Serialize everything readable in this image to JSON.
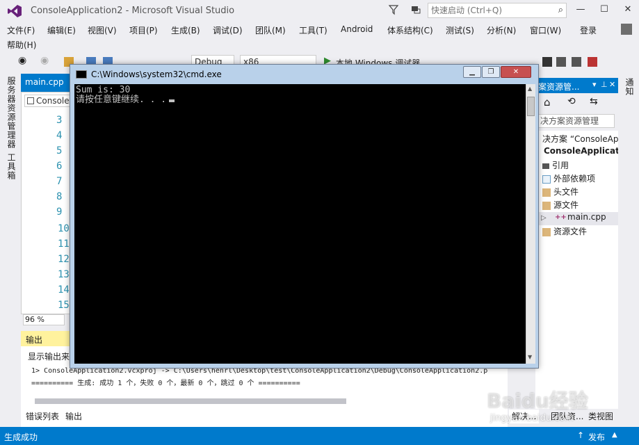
{
  "window": {
    "title": "ConsoleApplication2 - Microsoft Visual Studio",
    "quick_launch_placeholder": "快速启动 (Ctrl+Q)",
    "minimize": "—",
    "maximize": "☐",
    "close": "✕"
  },
  "menu": {
    "items": [
      "文件(F)",
      "编辑(E)",
      "视图(V)",
      "项目(P)",
      "生成(B)",
      "调试(D)",
      "团队(M)",
      "工具(T)",
      "Android",
      "体系结构(C)",
      "测试(S)",
      "分析(N)",
      "窗口(W)"
    ],
    "login": "登录",
    "help": "帮助(H)"
  },
  "toolbar": {
    "config": "Debug",
    "platform": "x86",
    "run": "本地 Windows 调试器"
  },
  "side_tabs": {
    "left": [
      "服务器资源管理器",
      "工具箱"
    ],
    "right": [
      "通知"
    ]
  },
  "editor": {
    "tab": "main.cpp",
    "nav_item": "Console",
    "line_numbers": [
      "3",
      "4",
      "5",
      "6",
      "7",
      "8",
      "9",
      "10",
      "11",
      "12",
      "13",
      "14",
      "15"
    ],
    "zoom": "96 %"
  },
  "output": {
    "title": "输出",
    "source_label": "显示输出来",
    "lines": [
      "1>  ConsoleApplication2.vcxproj -> C:\\Users\\henrl\\Desktop\\test\\ConsoleApplication2\\Debug\\ConsoleApplication2.p",
      "========== 生成: 成功 1 个，失败 0 个，最新 0 个，跳过 0 个 =========="
    ],
    "tabs": [
      "错误列表",
      "输出"
    ]
  },
  "solution_explorer": {
    "title": "案资源管...",
    "search_placeholder": "决方案资源管理",
    "items": [
      {
        "label": "决方案 “ConsoleAp",
        "indent": 0
      },
      {
        "label": "ConsoleApplicati",
        "indent": 0,
        "bold": true
      },
      {
        "label": "引用",
        "indent": 1
      },
      {
        "label": "外部依赖项",
        "indent": 1
      },
      {
        "label": "头文件",
        "indent": 1
      },
      {
        "label": "源文件",
        "indent": 1
      },
      {
        "label": "main.cpp",
        "indent": 2,
        "selected": true
      },
      {
        "label": "资源文件",
        "indent": 1
      }
    ],
    "bottom_tabs": [
      "解决...",
      "团队资...",
      "类视图"
    ]
  },
  "cmd": {
    "title": "C:\\Windows\\system32\\cmd.exe",
    "output_line1": "Sum is: 30",
    "output_line2": "请按任意键继续. . ."
  },
  "status": {
    "text": "生成成功",
    "publish": "发布"
  },
  "watermark": {
    "brand": "Baidu经验",
    "url": "jingyan.baidu.com"
  },
  "colors": {
    "accent": "#007acc",
    "chrome": "#eeeef2",
    "output_header": "#fff29d"
  }
}
